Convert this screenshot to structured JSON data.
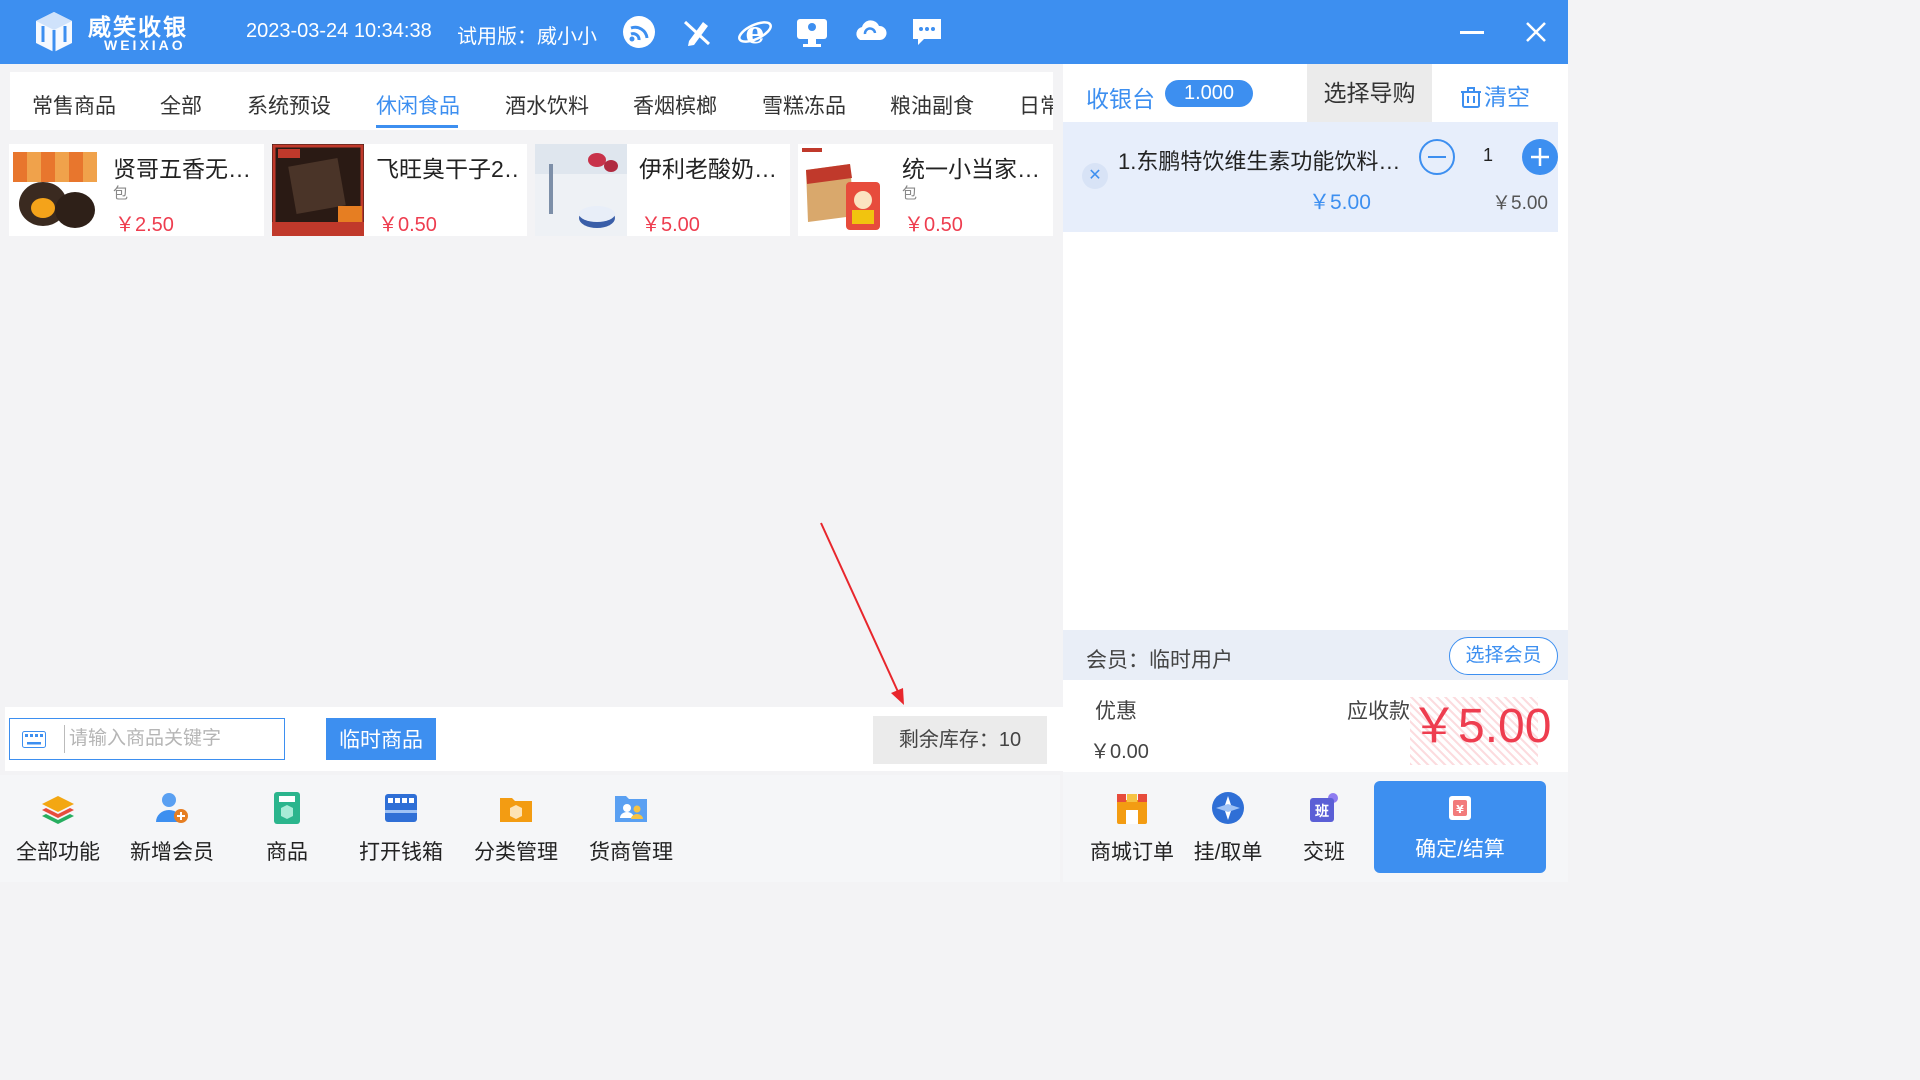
{
  "titlebar": {
    "brand_cn": "威笑收银",
    "brand_en": "WEIXIAO",
    "datetime": "2023-03-24 10:34:38",
    "trial": "试用版：威小小",
    "icons": [
      "wifi-icon",
      "no-pen-icon",
      "browser-icon",
      "remote-desktop-icon",
      "cloud-sync-icon",
      "message-icon"
    ],
    "bg_color": "#3d8ff0"
  },
  "tabs": [
    "常售商品",
    "全部",
    "系统预设",
    "休闲食品",
    "酒水饮料",
    "香烟槟榔",
    "雪糕冻品",
    "粮油副食",
    "日常"
  ],
  "active_tab": "休闲食品",
  "products": [
    {
      "name": "贤哥五香无…",
      "unit": "包",
      "price": "￥2.50"
    },
    {
      "name": "飞旺臭干子2…",
      "unit": "",
      "price": "￥0.50"
    },
    {
      "name": "伊利老酸奶…",
      "unit": "",
      "price": "￥5.00"
    },
    {
      "name": "统一小当家…",
      "unit": "包",
      "price": "￥0.50"
    }
  ],
  "product_images": [
    "egg-snack-image",
    "dried-tofu-image",
    "yogurt-image",
    "noodle-snack-image"
  ],
  "search": {
    "placeholder": "请输入商品关键字"
  },
  "temp_goods_label": "临时商品",
  "stock_text": "剩余库存：10",
  "toolbar": [
    {
      "label": "全部功能",
      "icon": "layers-icon"
    },
    {
      "label": "新增会员",
      "icon": "add-member-icon"
    },
    {
      "label": "商品",
      "icon": "goods-icon"
    },
    {
      "label": "打开钱箱",
      "icon": "cash-drawer-icon"
    },
    {
      "label": "分类管理",
      "icon": "category-icon"
    },
    {
      "label": "货商管理",
      "icon": "supplier-icon"
    }
  ],
  "right": {
    "cashier_label": "收银台",
    "cashier_value": "1.000",
    "guide_label": "选择导购",
    "clear_label": "清空",
    "cart_items": [
      {
        "name": "1.东鹏特饮维生素功能饮料…",
        "unit_price": "￥5.00",
        "qty": "1",
        "total": "￥5.00"
      }
    ],
    "member_label": "会员：临时用户",
    "member_btn": "选择会员",
    "discount_label": "优惠",
    "discount_value": "￥0.00",
    "due_label": "应收款",
    "due_value": "￥5.00"
  },
  "right_toolbar": [
    {
      "label": "商城订单",
      "icon": "mall-order-icon"
    },
    {
      "label": "挂/取单",
      "icon": "hold-order-icon"
    },
    {
      "label": "交班",
      "icon": "shift-icon"
    }
  ],
  "confirm_label": "确定/结算"
}
